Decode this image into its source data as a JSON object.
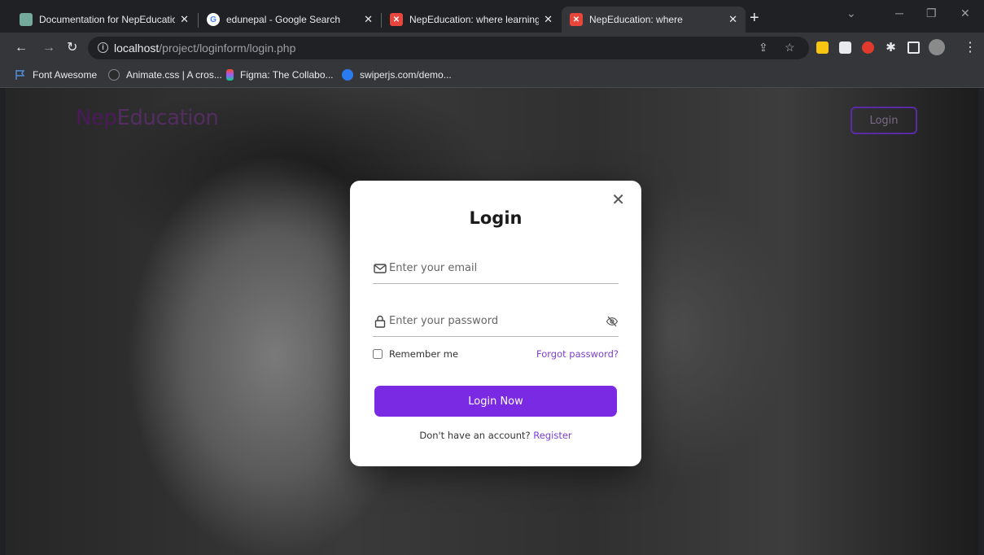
{
  "browser": {
    "tabs": [
      {
        "title": "Documentation for NepEducatio",
        "favicon": "chatgpt-icon",
        "color": "#74aa9c"
      },
      {
        "title": "edunepal - Google Search",
        "favicon": "google-icon",
        "color": "#4285f4"
      },
      {
        "title": "NepEducation: where learning ar",
        "favicon": "nepedu-icon",
        "color": "#e8453c"
      },
      {
        "title": "NepEducation: where",
        "favicon": "nepedu-icon",
        "color": "#e8453c"
      }
    ],
    "url_host": "localhost",
    "url_path": "/project/loginform/login.php",
    "bookmarks": [
      {
        "label": "Font Awesome",
        "icon": "flag-icon",
        "color": "#528dd7"
      },
      {
        "label": "Animate.css | A cros...",
        "icon": "animate-icon",
        "color": "#e8eaed"
      },
      {
        "label": "Figma: The Collabo...",
        "icon": "figma-icon",
        "color": "#f24e1e"
      },
      {
        "label": "swiperjs.com/demo...",
        "icon": "swiper-icon",
        "color": "#2b7bf0"
      }
    ]
  },
  "page": {
    "logo_part1": "Nep",
    "logo_part2": "Education",
    "header_login": "Login"
  },
  "modal": {
    "title": "Login",
    "email_placeholder": "Enter your email",
    "password_placeholder": "Enter your password",
    "remember_label": "Remember me",
    "forgot_label": "Forgot password?",
    "submit_label": "Login Now",
    "signup_text": "Don't have an account?",
    "signup_link": "Register",
    "accent": "#7a2ae3"
  }
}
